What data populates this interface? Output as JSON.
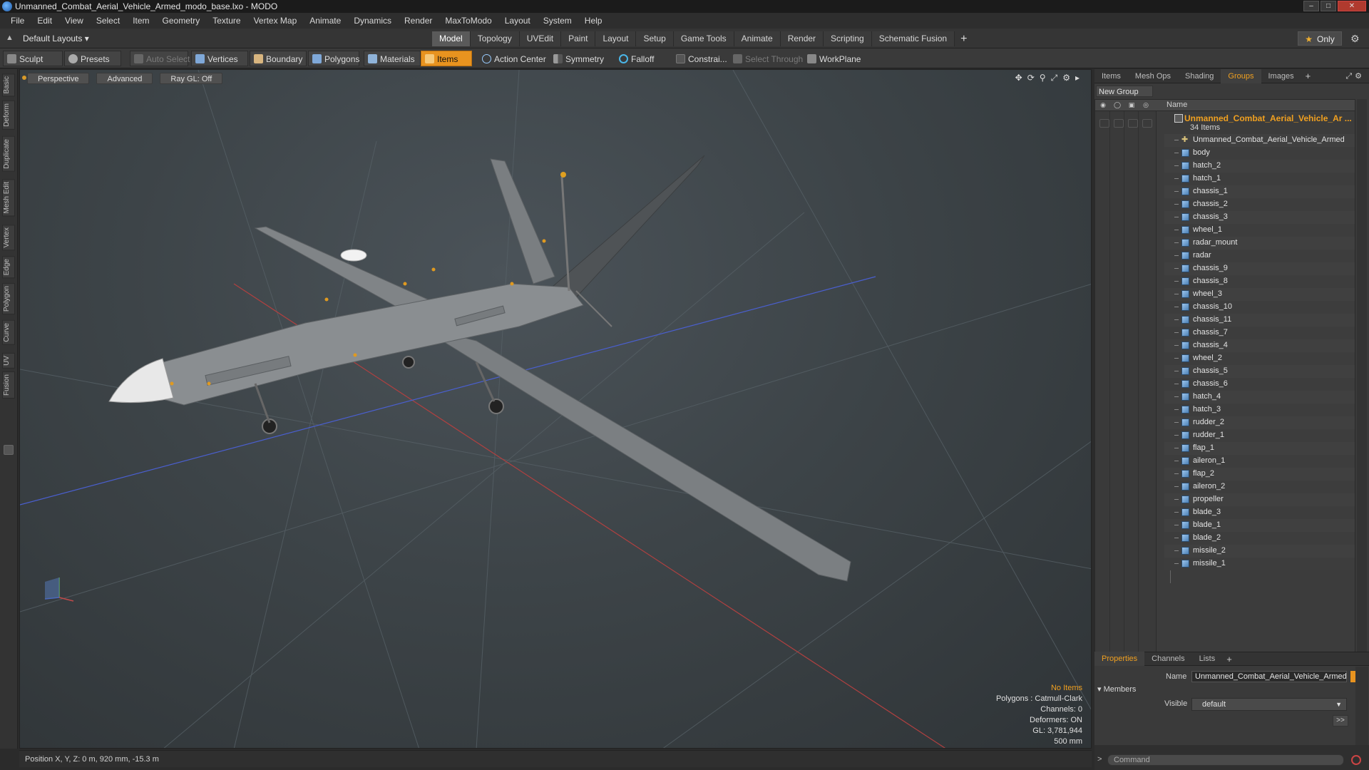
{
  "window": {
    "title": "Unmanned_Combat_Aerial_Vehicle_Armed_modo_base.lxo - MODO",
    "buttons": [
      "–",
      "□",
      "✕"
    ]
  },
  "menubar": [
    "File",
    "Edit",
    "View",
    "Select",
    "Item",
    "Geometry",
    "Texture",
    "Vertex Map",
    "Animate",
    "Dynamics",
    "Render",
    "MaxToModo",
    "Layout",
    "System",
    "Help"
  ],
  "layoutbar": {
    "layouts_dropdown": "Default Layouts ▾",
    "tabs": [
      "Model",
      "Topology",
      "UVEdit",
      "Paint",
      "Layout",
      "Setup",
      "Game Tools",
      "Animate",
      "Render",
      "Scripting",
      "Schematic Fusion"
    ],
    "active_tab": "Model",
    "add_tab": "+",
    "only_label": "Only"
  },
  "toolbar": {
    "sculpt": "Sculpt",
    "presets": "Presets",
    "auto_select": "Auto Select",
    "vertices": "Vertices",
    "boundary": "Boundary",
    "polygons": "Polygons",
    "materials": "Materials",
    "items": "Items",
    "action_center": "Action Center",
    "symmetry": "Symmetry",
    "falloff": "Falloff",
    "constraints": "Constrai...",
    "select_through": "Select Through",
    "workplane": "WorkPlane"
  },
  "left_tabs": [
    "Basic",
    "Deform",
    "Duplicate",
    "Mesh Edit",
    "Vertex",
    "Edge",
    "Polygon",
    "Curve",
    "UV",
    "Fusion"
  ],
  "viewport": {
    "view_mode": "Perspective",
    "shading": "Advanced",
    "raygl": "Ray GL: Off",
    "info": {
      "selection": "No Items",
      "polygons": "Polygons : Catmull-Clark",
      "channels": "Channels: 0",
      "deformers": "Deformers: ON",
      "gl": "GL: 3,781,944",
      "scale": "500 mm"
    }
  },
  "statusbar": {
    "position": "Position X, Y, Z:  0 m, 920 mm, -15.3 m"
  },
  "right_panel": {
    "top_tabs": [
      "Items",
      "Mesh Ops",
      "Shading",
      "Groups",
      "Images"
    ],
    "active_top_tab": "Groups",
    "new_group": "New Group",
    "name_header": "Name",
    "group": {
      "name": "Unmanned_Combat_Aerial_Vehicle_Ar ...",
      "count": "34 Items"
    },
    "items": [
      "Unmanned_Combat_Aerial_Vehicle_Armed",
      "body",
      "hatch_2",
      "hatch_1",
      "chassis_1",
      "chassis_2",
      "chassis_3",
      "wheel_1",
      "radar_mount",
      "radar",
      "chassis_9",
      "chassis_8",
      "wheel_3",
      "chassis_10",
      "chassis_11",
      "chassis_7",
      "chassis_4",
      "wheel_2",
      "chassis_5",
      "chassis_6",
      "hatch_4",
      "hatch_3",
      "rudder_2",
      "rudder_1",
      "flap_1",
      "aileron_1",
      "flap_2",
      "aileron_2",
      "propeller",
      "blade_3",
      "blade_1",
      "blade_2",
      "missile_2",
      "missile_1"
    ],
    "bottom_tabs": [
      "Properties",
      "Channels",
      "Lists"
    ],
    "active_bottom_tab": "Properties",
    "properties": {
      "name_label": "Name",
      "name_value": "Unmanned_Combat_Aerial_Vehicle_Armed (",
      "members_label": "Members",
      "visible_label": "Visible",
      "visible_value": "default",
      "more": ">>"
    },
    "command_placeholder": "Command"
  },
  "colors": {
    "accent": "#e8931f",
    "group_name": "#f0a020"
  }
}
